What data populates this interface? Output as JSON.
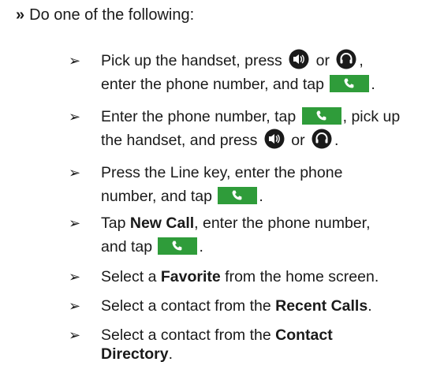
{
  "intro": {
    "marker": "»",
    "text": "Do one of the following:"
  },
  "bullet_glyph": "➢",
  "items": [
    {
      "l1a": "Pick up the handset, press",
      "l1b": "or",
      "l1c": ",",
      "l2a": "enter the phone number, and tap",
      "l2b": "."
    },
    {
      "l1a": "Enter the phone number, tap",
      "l1b": ", pick up",
      "l2a": "the handset, and press",
      "l2b": "or",
      "l2c": "."
    },
    {
      "l1": "Press the Line key, enter the phone",
      "l2a": "number, and tap",
      "l2b": "."
    },
    {
      "l1a": "Tap",
      "l1b": "New Call",
      "l1c": ", enter the phone number,",
      "l2a": "and tap",
      "l2b": "."
    },
    {
      "a": "Select a",
      "b": "Favorite",
      "c": "from the home screen."
    },
    {
      "a": "Select a contact from the",
      "b": "Recent Calls",
      "c": "."
    },
    {
      "a": "Select a contact from the",
      "b": "Contact",
      "d": "Directory",
      "c": "."
    }
  ],
  "icons": {
    "call_button_color": "#2f9c3a"
  }
}
